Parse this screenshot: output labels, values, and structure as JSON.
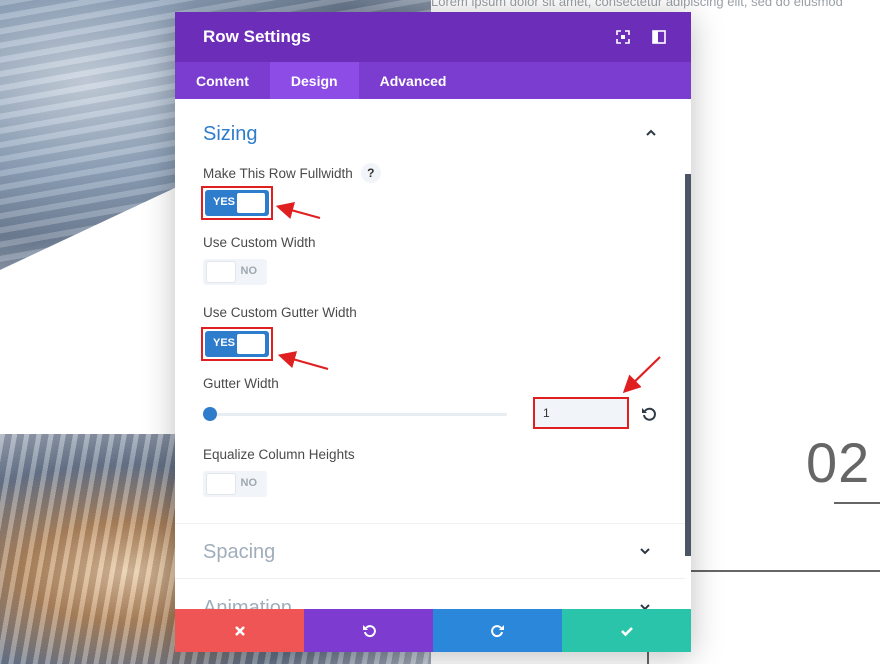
{
  "background": {
    "lorem_text": "Lorem ipsum dolor sit amet, consectetur adipiscing elit, sed do eiusmod",
    "big_number": "02"
  },
  "modal": {
    "title": "Row Settings",
    "header_icons": [
      "expand-icon",
      "sidebar-icon"
    ],
    "tabs": [
      {
        "label": "Content",
        "active": false
      },
      {
        "label": "Design",
        "active": true
      },
      {
        "label": "Advanced",
        "active": false
      }
    ],
    "sections": {
      "sizing": {
        "title": "Sizing",
        "fields": {
          "fullwidth": {
            "label": "Make This Row Fullwidth",
            "help": "?",
            "state": "YES"
          },
          "custom_width": {
            "label": "Use Custom Width",
            "state": "NO"
          },
          "custom_gutter": {
            "label": "Use Custom Gutter Width",
            "state": "YES"
          },
          "gutter_width": {
            "label": "Gutter Width",
            "value": "1"
          },
          "equalize": {
            "label": "Equalize Column Heights",
            "state": "NO"
          }
        }
      },
      "spacing": {
        "title": "Spacing"
      },
      "animation": {
        "title": "Animation"
      }
    },
    "footer": {
      "buttons": [
        "cancel-icon",
        "undo-icon",
        "redo-icon",
        "save-icon"
      ]
    }
  },
  "colors": {
    "header": "#6c2eb9",
    "tabs": "#7b3cd0",
    "accent": "#2e7ccc",
    "cancel": "#ef5555",
    "undo": "#7e3bd0",
    "redo": "#2b87da",
    "save": "#29c4a9",
    "annotation": "#e02020"
  }
}
